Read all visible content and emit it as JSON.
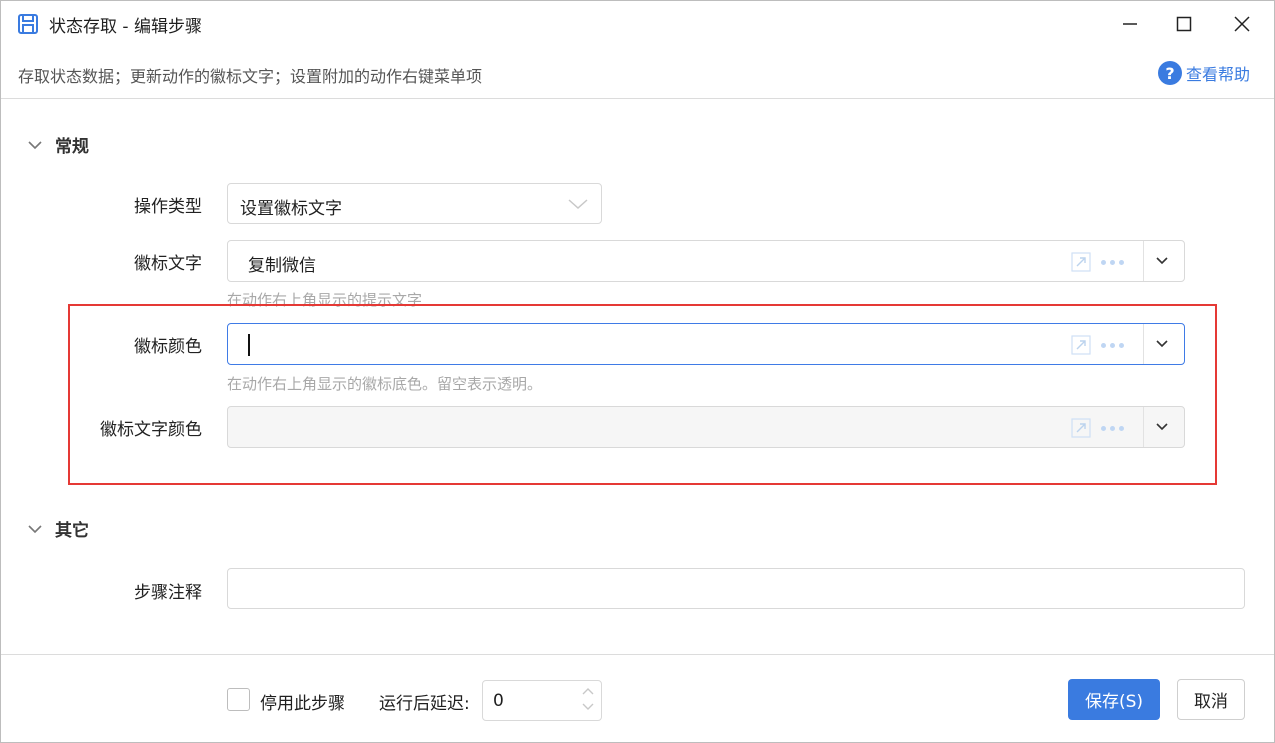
{
  "window": {
    "title": "状态存取 - 编辑步骤"
  },
  "description": "存取状态数据；更新动作的徽标文字；设置附加的动作右键菜单项",
  "help": {
    "label": "查看帮助"
  },
  "sections": {
    "general": "常规",
    "other": "其它"
  },
  "fields": {
    "op_type": {
      "label": "操作类型",
      "value": "设置徽标文字"
    },
    "badge_text": {
      "label": "徽标文字",
      "value": "复制微信",
      "hint": "在动作右上角显示的提示文字"
    },
    "badge_color": {
      "label": "徽标颜色",
      "value": "",
      "hint": "在动作右上角显示的徽标底色。留空表示透明。"
    },
    "badge_text_color": {
      "label": "徽标文字颜色",
      "value": ""
    },
    "step_note": {
      "label": "步骤注释",
      "value": ""
    }
  },
  "footer": {
    "disable_label": "停用此步骤",
    "delay_label": "运行后延迟:",
    "delay_value": "0",
    "save_label": "保存(S)",
    "cancel_label": "取消"
  },
  "colors": {
    "accent": "#3a7be0",
    "highlight_border": "#e53935",
    "focus_border": "#3f7be6"
  }
}
